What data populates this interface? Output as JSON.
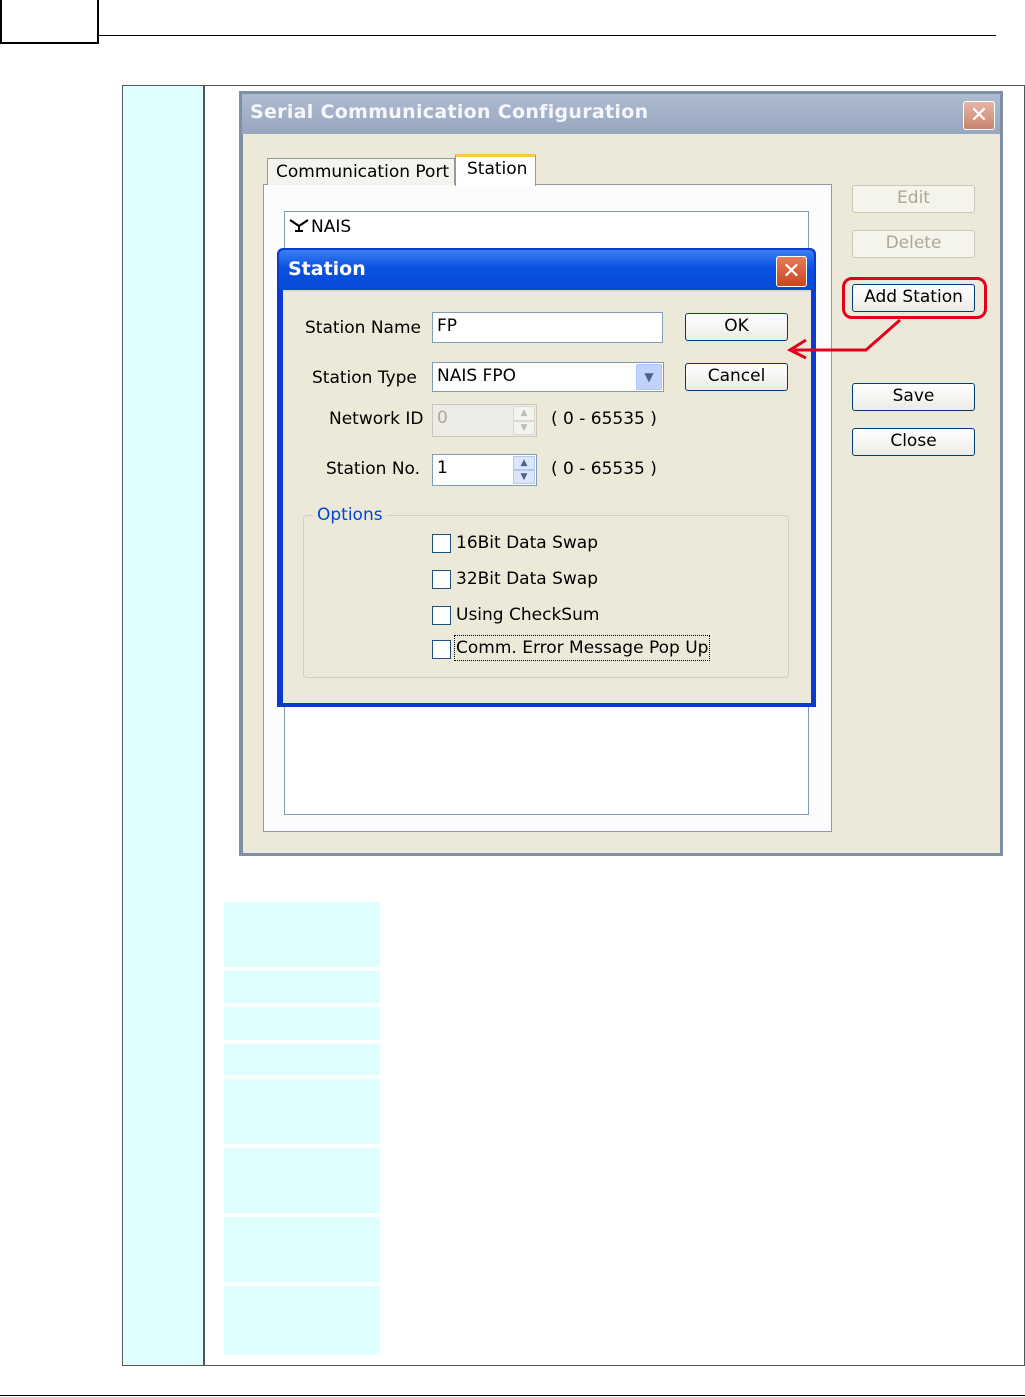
{
  "main_dialog": {
    "title": "Serial Communication Configuration",
    "close_glyph": "✕",
    "tabs": [
      {
        "label": "Communication Port",
        "active": false
      },
      {
        "label": "Station",
        "active": true
      }
    ],
    "station_tree_item": {
      "icon": "antenna-icon",
      "label": "NAIS"
    },
    "buttons": {
      "edit": "Edit",
      "delete": "Delete",
      "add_station": "Add Station",
      "save": "Save",
      "close": "Close"
    }
  },
  "station_dialog": {
    "title": "Station",
    "close_glyph": "✕",
    "station_name_label": "Station Name",
    "station_name_value": "FP",
    "station_type_label": "Station Type",
    "station_type_value": "NAIS FPO",
    "network_id_label": "Network ID",
    "network_id_value": "0",
    "network_id_range": "( 0 - 65535 )",
    "station_no_label": "Station No.",
    "station_no_value": "1",
    "station_no_range": "( 0 - 65535 )",
    "ok_label": "OK",
    "cancel_label": "Cancel",
    "options": {
      "legend": "Options",
      "checkboxes": [
        {
          "label": "16Bit Data Swap",
          "checked": false
        },
        {
          "label": "32Bit Data Swap",
          "checked": false
        },
        {
          "label": "Using CheckSum",
          "checked": false
        },
        {
          "label": "Comm. Error Message Pop Up",
          "checked": false,
          "focused": true
        }
      ]
    }
  },
  "annotation": {
    "highlight_color": "#e3001b"
  },
  "colors": {
    "title_bar_active": "#0a52e0",
    "title_bar_inactive": "#97a7bf",
    "dialog_face": "#ece9d8",
    "table_cell": "#dfffff"
  }
}
